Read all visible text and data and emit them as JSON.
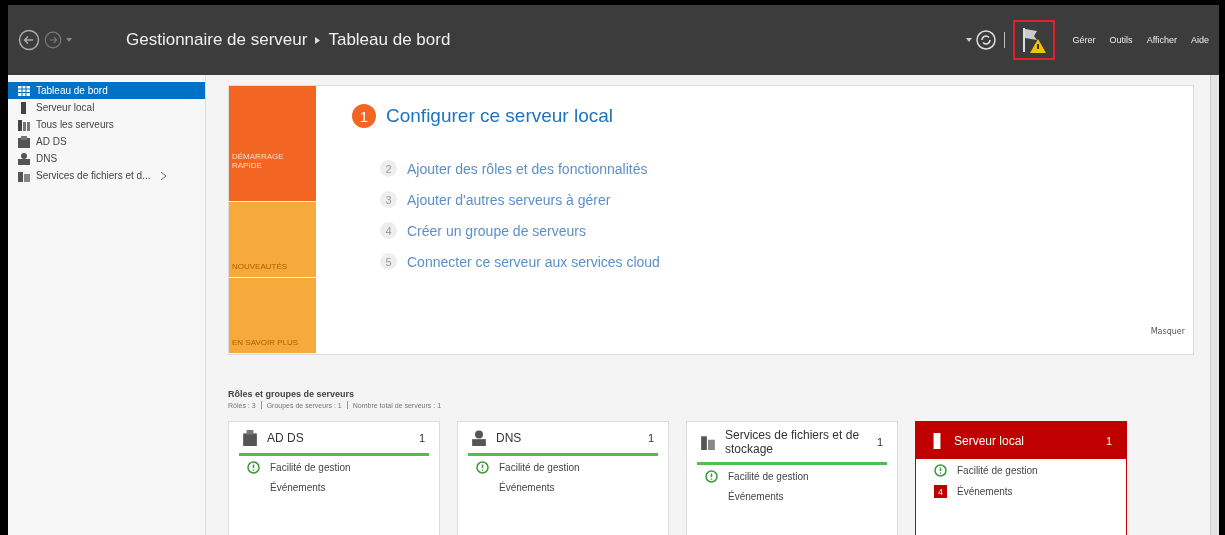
{
  "header": {
    "title": "Gestionnaire de serveur",
    "page": "Tableau de bord",
    "flag_alert": true,
    "menus": [
      "Gérer",
      "Outils",
      "Afficher",
      "Aide"
    ]
  },
  "sidebar": {
    "items": [
      {
        "label": "Tableau de bord",
        "selected": true,
        "submenu": false
      },
      {
        "label": "Serveur local",
        "selected": false,
        "submenu": false
      },
      {
        "label": "Tous les serveurs",
        "selected": false,
        "submenu": false
      },
      {
        "label": "AD DS",
        "selected": false,
        "submenu": false
      },
      {
        "label": "DNS",
        "selected": false,
        "submenu": false
      },
      {
        "label": "Services de fichiers et d...",
        "selected": false,
        "submenu": true
      }
    ]
  },
  "quick_start": {
    "tiles": [
      {
        "label": "DÉMARRAGE RAPIDE",
        "selected": true
      },
      {
        "label": "NOUVEAUTÉS",
        "selected": false
      },
      {
        "label": "EN SAVOIR PLUS",
        "selected": false
      }
    ],
    "steps": [
      {
        "number": "1",
        "label": "Configurer ce serveur local",
        "kind": "main"
      },
      {
        "number": "2",
        "label": "Ajouter des rôles et des fonctionnalités",
        "kind": "sub"
      },
      {
        "number": "3",
        "label": "Ajouter d'autres serveurs à gérer",
        "kind": "sub"
      },
      {
        "number": "4",
        "label": "Créer un groupe de serveurs",
        "kind": "sub"
      },
      {
        "number": "5",
        "label": "Connecter ce serveur aux services cloud",
        "kind": "sub"
      }
    ],
    "hide": "Masquer"
  },
  "roles": {
    "title": "Rôles et groupes de serveurs",
    "summary": [
      "Rôles : 3",
      "Groupes de serveurs : 1",
      "Nombre total de serveurs : 1"
    ],
    "cards": [
      {
        "name": "AD DS",
        "count": "1",
        "alert": false,
        "rows": [
          {
            "label": "Facilité de gestion",
            "kind": "ok"
          },
          {
            "label": "Événements",
            "kind": "plain"
          }
        ]
      },
      {
        "name": "DNS",
        "count": "1",
        "alert": false,
        "rows": [
          {
            "label": "Facilité de gestion",
            "kind": "ok"
          },
          {
            "label": "Événements",
            "kind": "plain"
          }
        ]
      },
      {
        "name": "Services de fichiers et de stockage",
        "count": "1",
        "alert": false,
        "rows": [
          {
            "label": "Facilité de gestion",
            "kind": "ok"
          },
          {
            "label": "Événements",
            "kind": "plain"
          }
        ]
      },
      {
        "name": "Serveur local",
        "count": "1",
        "alert": true,
        "rows": [
          {
            "label": "Facilité de gestion",
            "kind": "ok"
          },
          {
            "label": "Événements",
            "kind": "count",
            "badge": "4"
          }
        ]
      }
    ]
  }
}
